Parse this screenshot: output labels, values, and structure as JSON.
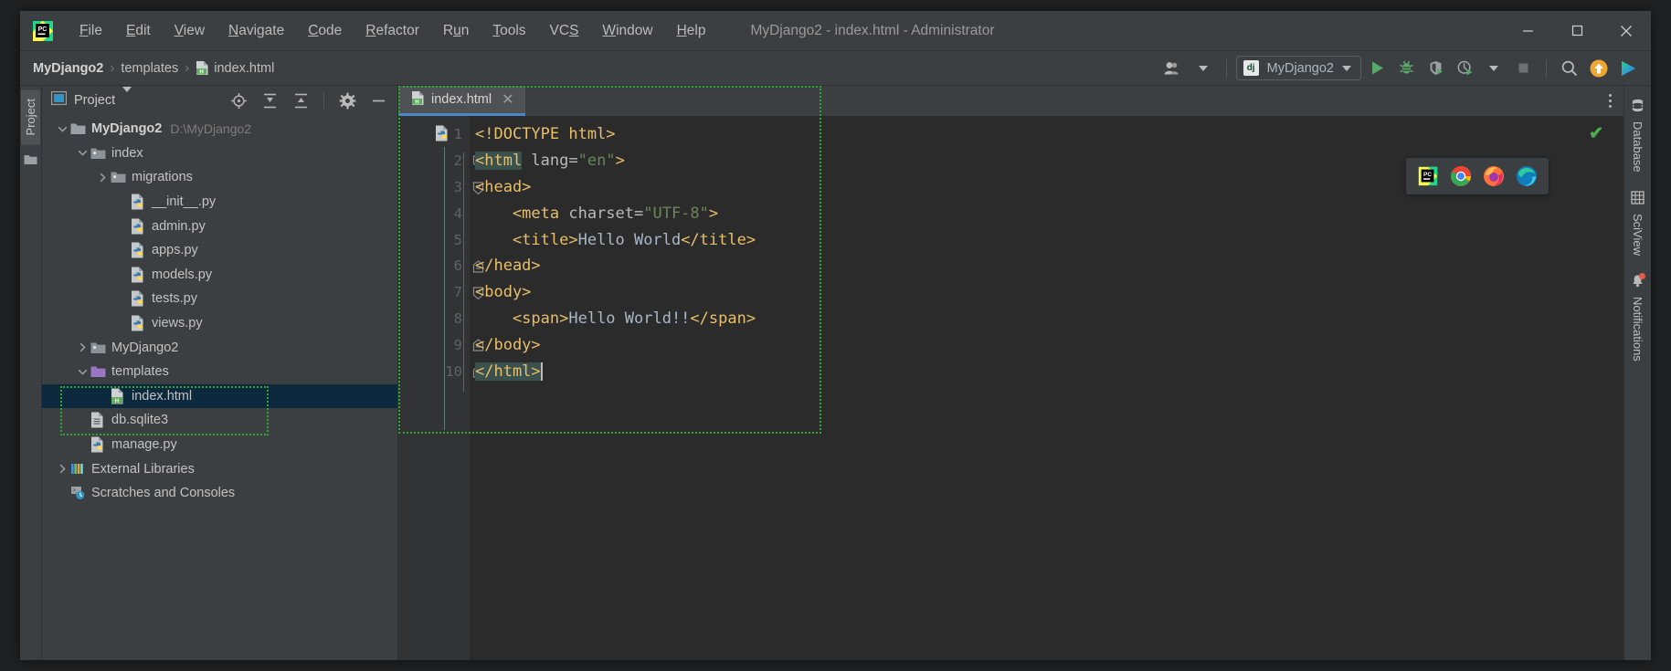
{
  "window": {
    "title": "MyDjango2 - index.html - Administrator",
    "minimize_label": "–",
    "maximize_label": "□",
    "close_label": "✕"
  },
  "menubar": {
    "items": [
      {
        "label": "File",
        "mnemonic": "F"
      },
      {
        "label": "Edit",
        "mnemonic": "E"
      },
      {
        "label": "View",
        "mnemonic": "V"
      },
      {
        "label": "Navigate",
        "mnemonic": "N"
      },
      {
        "label": "Code",
        "mnemonic": "C"
      },
      {
        "label": "Refactor",
        "mnemonic": "R"
      },
      {
        "label": "Run",
        "mnemonic": "u"
      },
      {
        "label": "Tools",
        "mnemonic": "T"
      },
      {
        "label": "VCS",
        "mnemonic": "S"
      },
      {
        "label": "Window",
        "mnemonic": "W"
      },
      {
        "label": "Help",
        "mnemonic": "H"
      }
    ]
  },
  "breadcrumb": {
    "items": [
      "MyDjango2",
      "templates",
      "index.html"
    ],
    "separator": "›"
  },
  "toolbar": {
    "run_config": "MyDjango2",
    "run_config_icon": "django-icon",
    "buttons": [
      {
        "name": "run-button",
        "title": "Run"
      },
      {
        "name": "debug-button",
        "title": "Debug"
      },
      {
        "name": "run-coverage-button",
        "title": "Run with Coverage"
      },
      {
        "name": "profile-button",
        "title": "Profile"
      },
      {
        "name": "stop-button",
        "title": "Stop"
      },
      {
        "name": "search-everywhere-button",
        "title": "Search Everywhere"
      },
      {
        "name": "update-button",
        "title": "Update Project"
      },
      {
        "name": "ide-assistant-button",
        "title": "Assistant"
      }
    ]
  },
  "left_rail": {
    "tab_label": "Project"
  },
  "project_panel": {
    "title": "Project",
    "tree": [
      {
        "label": "MyDjango2",
        "path": "D:\\MyDjango2",
        "indent": 0,
        "arrow": "down",
        "icon": "folder-icon",
        "bold": true,
        "selected": false
      },
      {
        "label": "index",
        "path": "",
        "indent": 1,
        "arrow": "down",
        "icon": "module-folder-icon",
        "bold": false,
        "selected": false
      },
      {
        "label": "migrations",
        "path": "",
        "indent": 2,
        "arrow": "right",
        "icon": "module-folder-icon",
        "bold": false,
        "selected": false
      },
      {
        "label": "__init__.py",
        "path": "",
        "indent": 3,
        "arrow": "none",
        "icon": "python-file-icon",
        "bold": false,
        "selected": false
      },
      {
        "label": "admin.py",
        "path": "",
        "indent": 3,
        "arrow": "none",
        "icon": "python-file-icon",
        "bold": false,
        "selected": false
      },
      {
        "label": "apps.py",
        "path": "",
        "indent": 3,
        "arrow": "none",
        "icon": "python-file-icon",
        "bold": false,
        "selected": false
      },
      {
        "label": "models.py",
        "path": "",
        "indent": 3,
        "arrow": "none",
        "icon": "python-file-icon",
        "bold": false,
        "selected": false
      },
      {
        "label": "tests.py",
        "path": "",
        "indent": 3,
        "arrow": "none",
        "icon": "python-file-icon",
        "bold": false,
        "selected": false
      },
      {
        "label": "views.py",
        "path": "",
        "indent": 3,
        "arrow": "none",
        "icon": "python-file-icon",
        "bold": false,
        "selected": false
      },
      {
        "label": "MyDjango2",
        "path": "",
        "indent": 1,
        "arrow": "right",
        "icon": "module-folder-icon",
        "bold": false,
        "selected": false
      },
      {
        "label": "templates",
        "path": "",
        "indent": 1,
        "arrow": "down",
        "icon": "templates-folder-icon",
        "bold": false,
        "selected": false
      },
      {
        "label": "index.html",
        "path": "",
        "indent": 2,
        "arrow": "none",
        "icon": "html-file-icon",
        "bold": false,
        "selected": true
      },
      {
        "label": "db.sqlite3",
        "path": "",
        "indent": 1,
        "arrow": "none",
        "icon": "database-file-icon",
        "bold": false,
        "selected": false
      },
      {
        "label": "manage.py",
        "path": "",
        "indent": 1,
        "arrow": "none",
        "icon": "python-file-icon",
        "bold": false,
        "selected": false
      },
      {
        "label": "External Libraries",
        "path": "",
        "indent": 0,
        "arrow": "right",
        "icon": "libraries-icon",
        "bold": false,
        "selected": false
      },
      {
        "label": "Scratches and Consoles",
        "path": "",
        "indent": 0,
        "arrow": "none",
        "icon": "scratches-icon",
        "bold": false,
        "selected": false
      }
    ]
  },
  "editor": {
    "tab": {
      "label": "index.html",
      "icon": "html-file-icon",
      "close": "✕"
    },
    "lines": [
      {
        "n": "1",
        "segments": [
          {
            "t": "<!DOCTYPE html>",
            "c": "tag"
          }
        ],
        "fold": "none",
        "runicon": true
      },
      {
        "n": "2",
        "segments": [
          {
            "t": "<html",
            "c": "tag hl"
          },
          {
            "t": " lang=",
            "c": "attr"
          },
          {
            "t": "\"en\"",
            "c": "val"
          },
          {
            "t": ">",
            "c": "tag"
          }
        ],
        "fold": "open",
        "runicon": false
      },
      {
        "n": "3",
        "segments": [
          {
            "t": "<head>",
            "c": "tag"
          }
        ],
        "fold": "open",
        "runicon": false
      },
      {
        "n": "4",
        "segments": [
          {
            "t": "    <meta ",
            "c": "tag"
          },
          {
            "t": "charset=",
            "c": "attr"
          },
          {
            "t": "\"UTF-8\"",
            "c": "val"
          },
          {
            "t": ">",
            "c": "tag"
          }
        ],
        "fold": "none",
        "runicon": false
      },
      {
        "n": "5",
        "segments": [
          {
            "t": "    <title>",
            "c": "tag"
          },
          {
            "t": "Hello World",
            "c": "txt"
          },
          {
            "t": "</title>",
            "c": "tag"
          }
        ],
        "fold": "none",
        "runicon": false
      },
      {
        "n": "6",
        "segments": [
          {
            "t": "</head>",
            "c": "tag"
          }
        ],
        "fold": "close",
        "runicon": false
      },
      {
        "n": "7",
        "segments": [
          {
            "t": "<body>",
            "c": "tag"
          }
        ],
        "fold": "open",
        "runicon": false
      },
      {
        "n": "8",
        "segments": [
          {
            "t": "    <span>",
            "c": "tag"
          },
          {
            "t": "Hello World!!",
            "c": "txt"
          },
          {
            "t": "</span>",
            "c": "tag"
          }
        ],
        "fold": "none",
        "runicon": false
      },
      {
        "n": "9",
        "segments": [
          {
            "t": "</body>",
            "c": "tag"
          }
        ],
        "fold": "close",
        "runicon": false
      },
      {
        "n": "10",
        "segments": [
          {
            "t": "</html>",
            "c": "tag hl"
          }
        ],
        "fold": "close",
        "runicon": false,
        "cursor": true
      }
    ],
    "inspection_status": "✔",
    "browser_popup": [
      "pycharm-icon",
      "chrome-icon",
      "firefox-icon",
      "edge-icon"
    ]
  },
  "right_rail": {
    "items": [
      {
        "label": "Database",
        "icon": "database-icon"
      },
      {
        "label": "SciView",
        "icon": "sciview-grid-icon"
      },
      {
        "label": "Notifications",
        "icon": "bell-icon"
      }
    ]
  },
  "colors": {
    "chrome": "#3c3f41",
    "editor_bg": "#2b2b2b",
    "gutter_bg": "#313335",
    "selection": "#0d293e",
    "tab_underline": "#4a88c7",
    "annotation_green": "#2fa82f",
    "tag": "#e8bf6a",
    "attr_value": "#6a8759",
    "text": "#a9b7c6",
    "match_highlight": "#3b514d",
    "run_green": "#57965c"
  }
}
